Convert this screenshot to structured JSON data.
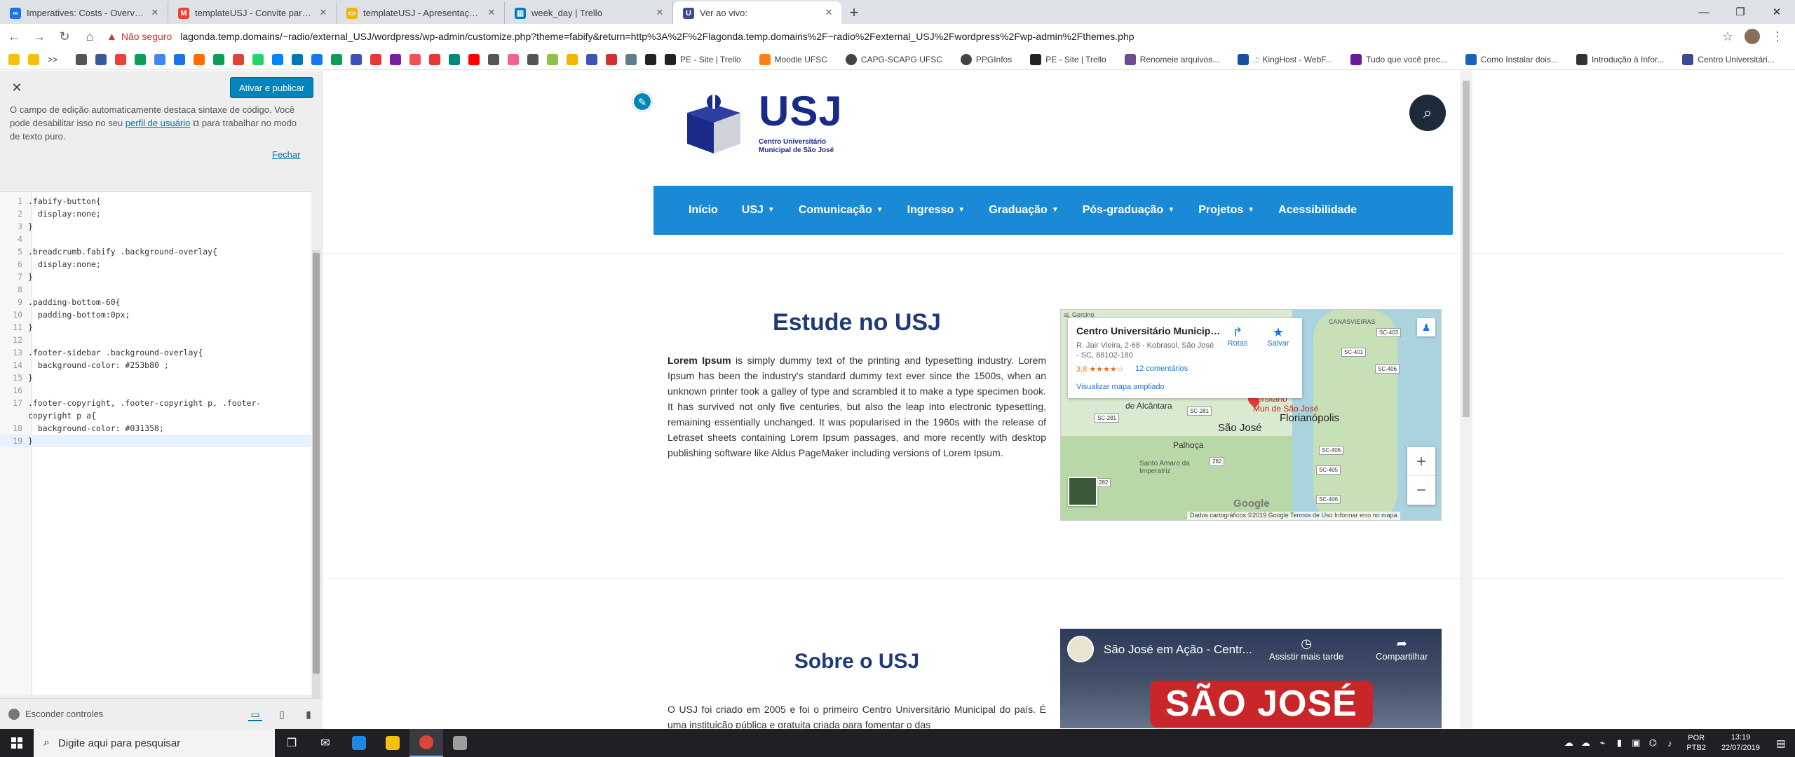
{
  "browser": {
    "tabs": [
      {
        "title": "Imperatives: Costs - Overview of...",
        "favicon_color": "#1a73e8"
      },
      {
        "title": "templateUSJ - Convite para edita...",
        "favicon_color": "#ea4335"
      },
      {
        "title": "templateUSJ - Apresentações Go...",
        "favicon_color": "#f4b400"
      },
      {
        "title": "week_day | Trello",
        "favicon_color": "#0079bf"
      },
      {
        "title": "Ver ao vivo:",
        "favicon_color": "#3c4a96"
      }
    ],
    "new_tab": "+",
    "window_controls": [
      "—",
      "❐",
      "✕"
    ],
    "security_label": "Não seguro",
    "url": "lagonda.temp.domains/~radio/external_USJ/wordpress/wp-admin/customize.php?theme=fabify&return=http%3A%2F%2Flagonda.temp.domains%2F~radio%2Fexternal_USJ%2Fwordpress%2Fwp-admin%2Fthemes.php",
    "bookmark_more": ">>",
    "bookmarks": [
      {
        "label": "PE - Site | Trello",
        "color": "#222"
      },
      {
        "label": "Moodle UFSC",
        "color": "#f98012"
      },
      {
        "label": "CAPG-SCAPG UFSC",
        "color": "#444"
      },
      {
        "label": "PPGInfos",
        "color": "#444"
      },
      {
        "label": "PE - Site | Trello",
        "color": "#222"
      },
      {
        "label": "Renomeie arquivos...",
        "color": "#6a4c93"
      },
      {
        "label": ".:: KingHost - WebF...",
        "color": "#1a4fa0"
      },
      {
        "label": "Tudo que você prec...",
        "color": "#6a1b9a"
      },
      {
        "label": "Como Instalar dois...",
        "color": "#1565c0"
      },
      {
        "label": "Introdução à Infor...",
        "color": "#333"
      },
      {
        "label": "Centro Universitári...",
        "color": "#3c4a96"
      }
    ],
    "bookmark_icon_colors": [
      "#f4c20d",
      "#f4c20d",
      "#555",
      "#3b5998",
      "#ea4335",
      "#0f9d58",
      "#4285f4",
      "#1a73e8",
      "#ff6d00",
      "#0f9d58",
      "#db4437",
      "#25d366",
      "#0084ff",
      "#0077b5",
      "#1877f2",
      "#0f9d58",
      "#3f51b5",
      "#e53935",
      "#7b1fa2",
      "#ef5350",
      "#e53935",
      "#00897b",
      "#ff0000",
      "#555",
      "#f06292",
      "#555",
      "#8bc34a",
      "#f4b400",
      "#3f51b5",
      "#d32f2f",
      "#607d8b",
      "#222"
    ]
  },
  "customizer": {
    "publish_label": "Ativar e publicar",
    "notice_prefix": "O campo de edição automaticamente destaca sintaxe de código. Você pode desabilitar isso no seu",
    "notice_link": "perfil de usuário",
    "notice_suffix": "para trabalhar no modo de texto puro.",
    "close_notice": "Fechar",
    "code_lines": [
      {
        "n": "1",
        "text": ".fabify-button{"
      },
      {
        "n": "2",
        "text": "  display:none;"
      },
      {
        "n": "3",
        "text": "}"
      },
      {
        "n": "4",
        "text": ""
      },
      {
        "n": "5",
        "text": ".breadcrumb.fabify .background-overlay{"
      },
      {
        "n": "6",
        "text": "  display:none;"
      },
      {
        "n": "7",
        "text": "}"
      },
      {
        "n": "8",
        "text": ""
      },
      {
        "n": "9",
        "text": ".padding-bottom-60{"
      },
      {
        "n": "10",
        "text": "  padding-bottom:0px;"
      },
      {
        "n": "11",
        "text": "}"
      },
      {
        "n": "12",
        "text": ""
      },
      {
        "n": "13",
        "text": ".footer-sidebar .background-overlay{"
      },
      {
        "n": "14",
        "text": "  background-color: #253b80 ;"
      },
      {
        "n": "15",
        "text": "}"
      },
      {
        "n": "16",
        "text": ""
      },
      {
        "n": "17",
        "text": ".footer-copyright, .footer-copyright p, .footer-"
      },
      {
        "n": "",
        "text": "copyright p a{"
      },
      {
        "n": "18",
        "text": "  background-color: #031358;"
      },
      {
        "n": "19",
        "text": "}"
      }
    ],
    "hide_controls": "Esconder controles"
  },
  "site": {
    "logo_text": "USJ",
    "logo_sub": "Centro Universitário Municipal de São José",
    "nav": [
      {
        "label": "Início",
        "dropdown": false
      },
      {
        "label": "USJ",
        "dropdown": true
      },
      {
        "label": "Comunicação",
        "dropdown": true
      },
      {
        "label": "Ingresso",
        "dropdown": true
      },
      {
        "label": "Graduação",
        "dropdown": true
      },
      {
        "label": "Pós-graduação",
        "dropdown": true
      },
      {
        "label": "Projetos",
        "dropdown": true
      },
      {
        "label": "Acessibilidade",
        "dropdown": false
      }
    ],
    "section1_title": "Estude no USJ",
    "section1_bold": "Lorem Ipsum",
    "section1_text": " is simply dummy text of the printing and typesetting industry. Lorem Ipsum has been the industry's standard dummy text ever since the 1500s, when an unknown printer took a galley of type and scrambled it to make a type specimen book. It has survived not only five centuries, but also the leap into electronic typesetting, remaining essentially unchanged. It was popularised in the 1960s with the release of Letraset sheets containing Lorem Ipsum passages, and more recently with desktop publishing software like Aldus PageMaker including versions of Lorem Ipsum.",
    "map": {
      "place_name": "Centro Universitário Municipal...",
      "address": "R. Jair Vieira, 2-68 - Kobrasol, São José - SC, 88102-180",
      "rating": "3,8 ★★★★☆",
      "reviews": "12 comentários",
      "larger_map": "Visualizar mapa ampliado",
      "directions": "Rotas",
      "save": "Salvar",
      "labels": {
        "gercino": "aj. Gercino",
        "canasvieiras": "CANASVIEIRAS",
        "sao_jose": "São José",
        "florianopolis": "Florianópolis",
        "palhoca": "Palhoça",
        "santo_amaro": "Santo Amaro da Imperatriz",
        "alcantara": "de Alcântara",
        "mun_sao_jose": "Mun de São José",
        "universitario": "versitário"
      },
      "roads": [
        "SC-403",
        "SC-401",
        "SC-406",
        "SC-281",
        "SC-281",
        "282",
        "SC-405",
        "SC-406",
        "SC-406",
        "282"
      ],
      "zoom_in": "+",
      "zoom_out": "−",
      "google": "Google",
      "footer": "Dados cartográficos ©2019 Google    Termos de Uso    Informar erro no mapa"
    },
    "section2_title": "Sobre o USJ",
    "section2_text": "O USJ foi criado em 2005 e foi o primeiro Centro Universitário Municipal do país. É uma instituição pública e gratuita criada para fomentar o das",
    "video": {
      "title": "São José em Ação - Centr...",
      "watch_later": "Assistir mais tarde",
      "share": "Compartilhar",
      "banner": "SÃO JOSÉ"
    }
  },
  "taskbar": {
    "search_placeholder": "Digite aqui para pesquisar",
    "lang_top": "POR",
    "lang_bottom": "PTB2",
    "time": "13:19",
    "date": "22/07/2019"
  }
}
